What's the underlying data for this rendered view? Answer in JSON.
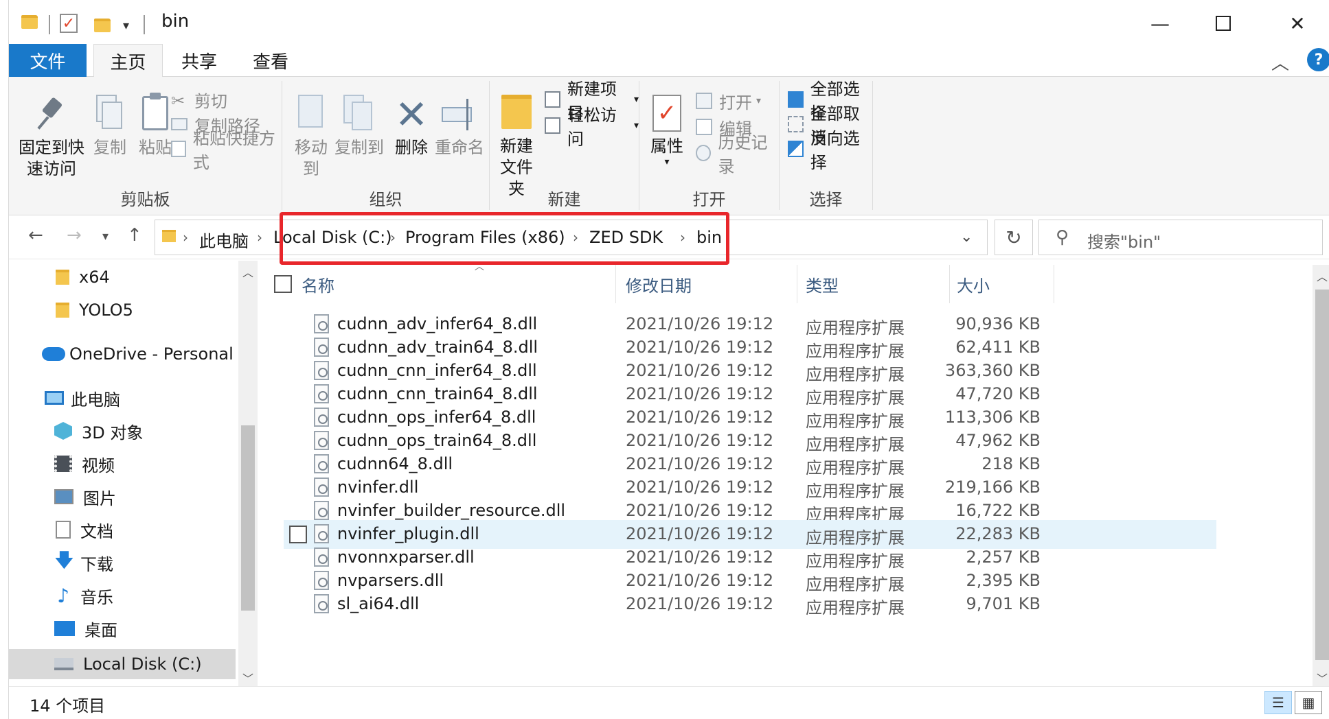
{
  "window": {
    "title": "bin"
  },
  "ribbon": {
    "tabs": [
      "文件",
      "主页",
      "共享",
      "查看"
    ],
    "clipboard": {
      "label": "剪贴板",
      "pin": "固定到快\n速访问",
      "pin_line1": "固定到快",
      "pin_line2": "速访问",
      "copy": "复制",
      "paste": "粘贴",
      "cut": "剪切",
      "copy_path": "复制路径",
      "paste_shortcut": "粘贴快捷方式"
    },
    "organize": {
      "label": "组织",
      "move_to": "移动到",
      "copy_to": "复制到",
      "delete": "删除",
      "rename": "重命名"
    },
    "new": {
      "label": "新建",
      "new_folder_line1": "新建",
      "new_folder_line2": "文件夹",
      "new_item": "新建项目",
      "easy_access": "轻松访问"
    },
    "open": {
      "label": "打开",
      "properties": "属性",
      "open": "打开",
      "edit": "编辑",
      "history": "历史记录"
    },
    "select": {
      "label": "选择",
      "select_all": "全部选择",
      "select_none": "全部取消",
      "invert": "反向选择"
    }
  },
  "address": {
    "crumbs": [
      "此电脑",
      "Local Disk (C:)",
      "Program Files (x86)",
      "ZED SDK",
      "bin"
    ],
    "search_placeholder": "搜索\"bin\""
  },
  "navpane": {
    "items": [
      "x64",
      "YOLO5",
      "OneDrive - Personal",
      "此电脑",
      "3D 对象",
      "视频",
      "图片",
      "文档",
      "下载",
      "音乐",
      "桌面",
      "Local Disk (C:)"
    ]
  },
  "columns": {
    "name": "名称",
    "date": "修改日期",
    "type": "类型",
    "size": "大小"
  },
  "files": [
    {
      "name": "cudnn_adv_infer64_8.dll",
      "date": "2021/10/26 19:12",
      "type": "应用程序扩展",
      "size": "90,936 KB"
    },
    {
      "name": "cudnn_adv_train64_8.dll",
      "date": "2021/10/26 19:12",
      "type": "应用程序扩展",
      "size": "62,411 KB"
    },
    {
      "name": "cudnn_cnn_infer64_8.dll",
      "date": "2021/10/26 19:12",
      "type": "应用程序扩展",
      "size": "363,360 KB"
    },
    {
      "name": "cudnn_cnn_train64_8.dll",
      "date": "2021/10/26 19:12",
      "type": "应用程序扩展",
      "size": "47,720 KB"
    },
    {
      "name": "cudnn_ops_infer64_8.dll",
      "date": "2021/10/26 19:12",
      "type": "应用程序扩展",
      "size": "113,306 KB"
    },
    {
      "name": "cudnn_ops_train64_8.dll",
      "date": "2021/10/26 19:12",
      "type": "应用程序扩展",
      "size": "47,962 KB"
    },
    {
      "name": "cudnn64_8.dll",
      "date": "2021/10/26 19:12",
      "type": "应用程序扩展",
      "size": "218 KB"
    },
    {
      "name": "nvinfer.dll",
      "date": "2021/10/26 19:12",
      "type": "应用程序扩展",
      "size": "219,166 KB"
    },
    {
      "name": "nvinfer_builder_resource.dll",
      "date": "2021/10/26 19:12",
      "type": "应用程序扩展",
      "size": "16,722 KB"
    },
    {
      "name": "nvinfer_plugin.dll",
      "date": "2021/10/26 19:12",
      "type": "应用程序扩展",
      "size": "22,283 KB"
    },
    {
      "name": "nvonnxparser.dll",
      "date": "2021/10/26 19:12",
      "type": "应用程序扩展",
      "size": "2,257 KB"
    },
    {
      "name": "nvparsers.dll",
      "date": "2021/10/26 19:12",
      "type": "应用程序扩展",
      "size": "2,395 KB"
    },
    {
      "name": "sl_ai64.dll",
      "date": "2021/10/26 19:12",
      "type": "应用程序扩展",
      "size": "9,701 KB"
    }
  ],
  "status": {
    "count": "14 个项目"
  },
  "colors": {
    "accent": "#1979ca",
    "highlight": "#e8262b",
    "hover_row": "#e5f3fb"
  }
}
